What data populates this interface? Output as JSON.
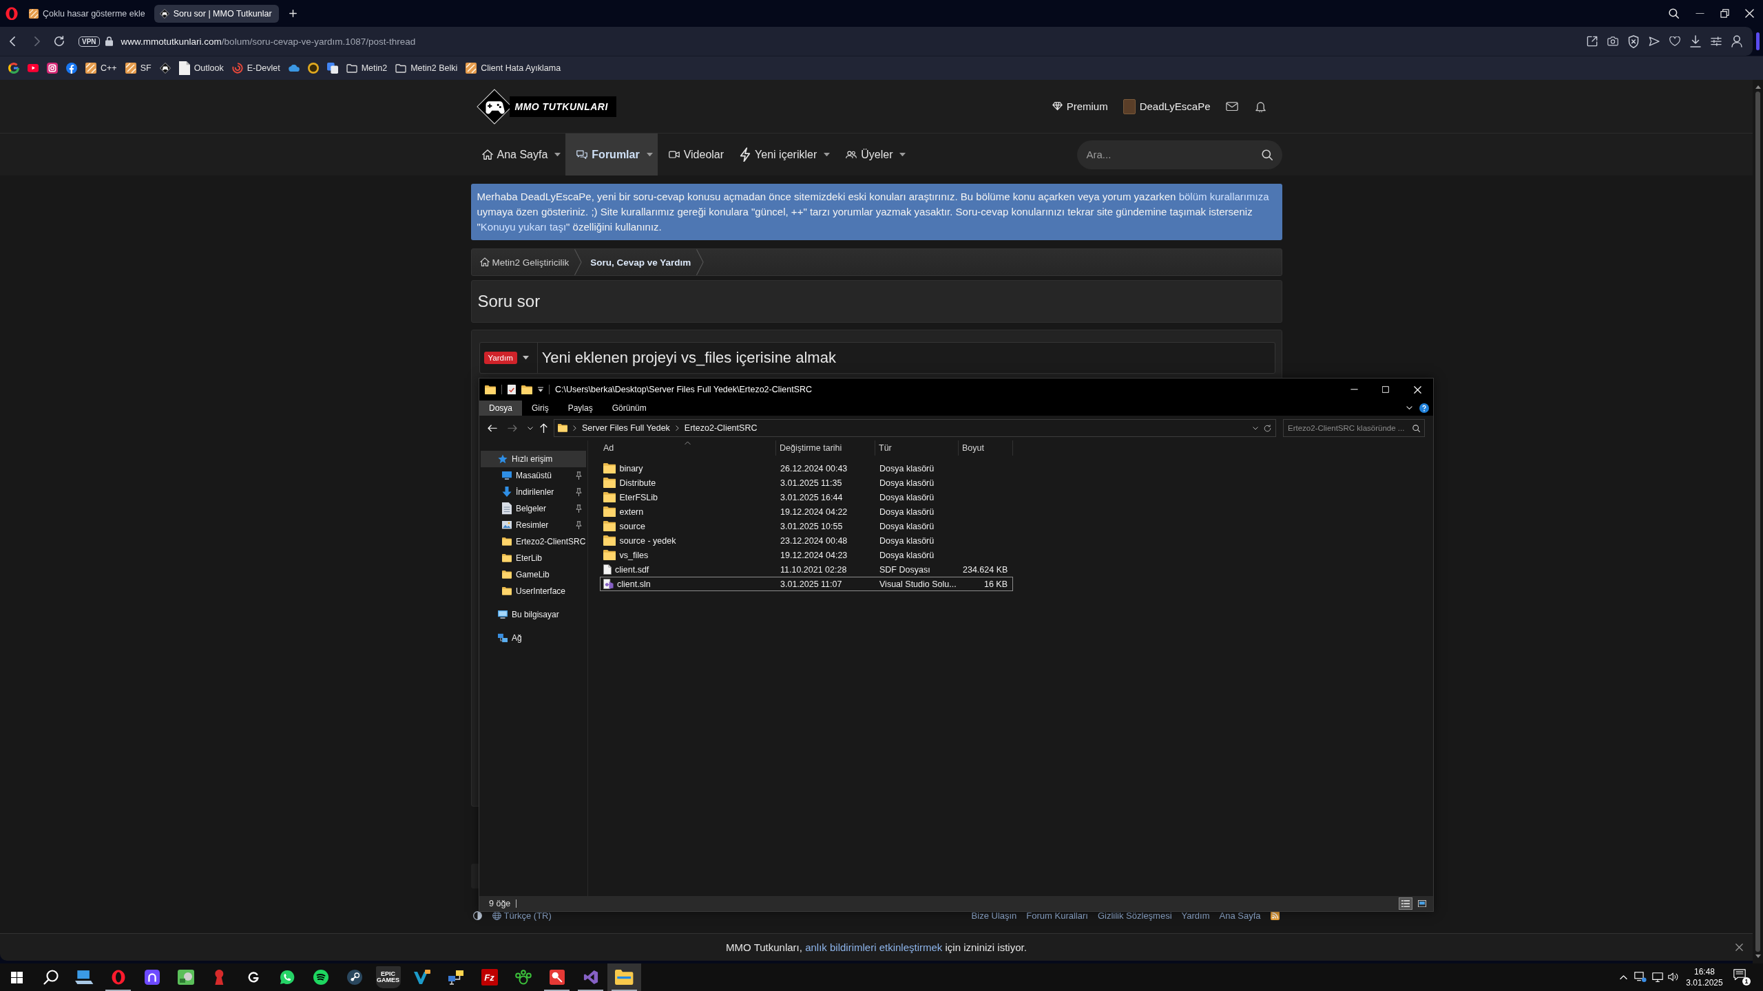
{
  "browser": {
    "tabs": [
      {
        "kind": "tile",
        "title": "Çoklu hasar gösterme ekle",
        "selected": false
      },
      {
        "kind": "mascot",
        "title": "Soru sor | MMO Tutkunlar",
        "selected": true
      }
    ],
    "history": {
      "can_go_back": true,
      "can_go_forward": false
    },
    "address": {
      "badge": "VPN",
      "host": "www.mmotutkunlari.com",
      "path": "/bolum/soru-cevap-ve-yardım.1087/post-thread"
    },
    "bookmarks": [
      {
        "kind": "google"
      },
      {
        "kind": "youtube"
      },
      {
        "kind": "instagram"
      },
      {
        "kind": "facebook"
      },
      {
        "kind": "tile",
        "label": "C++"
      },
      {
        "kind": "tile",
        "label": "SF"
      },
      {
        "kind": "mascot"
      },
      {
        "kind": "page",
        "label": "Outlook"
      },
      {
        "kind": "swirl",
        "label": "E-Devlet"
      },
      {
        "kind": "cloud"
      },
      {
        "kind": "coin"
      },
      {
        "kind": "translate"
      },
      {
        "kind": "folder",
        "label": "Metin2"
      },
      {
        "kind": "folder",
        "label": "Metin2 Belki"
      },
      {
        "kind": "tile",
        "label": "Client Hata Ayıklama"
      }
    ]
  },
  "site": {
    "logo": "MMO TUTKUNLARI",
    "account": [
      {
        "kind": "premium",
        "label": "Premium"
      },
      {
        "kind": "user",
        "label": "DeadLyEscaPe"
      },
      {
        "kind": "mail"
      },
      {
        "kind": "bell"
      }
    ],
    "nav": [
      {
        "kind": "home",
        "label": "Ana Sayfa",
        "dropdown": true,
        "selected": false
      },
      {
        "kind": "chat",
        "label": "Forumlar",
        "dropdown": true,
        "selected": true
      },
      {
        "kind": "video",
        "label": "Videolar",
        "dropdown": false,
        "selected": false
      },
      {
        "kind": "bolt",
        "label": "Yeni içerikler",
        "dropdown": true,
        "selected": false
      },
      {
        "kind": "users",
        "label": "Üyeler",
        "dropdown": true,
        "selected": false
      }
    ],
    "search": {
      "placeholder": "Ara..."
    },
    "notice": [
      {
        "kind": "text",
        "text": "Merhaba DeadLyEscaPe, yeni bir soru-cevap konusu açmadan önce sitemizdeki eski konuları araştırınız. Bu bölüme konu açarken veya yorum yazarken "
      },
      {
        "kind": "link",
        "text": "bölüm kurallarımıza"
      },
      {
        "kind": "text",
        "text": " uymaya özen gösteriniz. ;) Site kurallarımız gereği konulara \"güncel, ++\" tarzı yorumlar yazmak yasaktır. Soru-cevap konularınızı tekrar site gündemine taşımak isterseniz \""
      },
      {
        "kind": "link",
        "text": "Konuyu yukarı taşı"
      },
      {
        "kind": "text",
        "text": "\" özelliğini kullanınız."
      }
    ],
    "breadcrumb": [
      {
        "label": "Metin2 Geliştiricilik",
        "current": false
      },
      {
        "label": "Soru, Cevap ve Yardım",
        "current": true
      }
    ],
    "page_title": "Soru sor",
    "form": {
      "prefix": "Yardım",
      "title_field": {
        "value": "Yeni eklenen projeyi vs_files içerisine almak"
      }
    },
    "footer": {
      "language": "Türkçe (TR)",
      "links": [
        "Bize Ulaşın",
        "Forum Kuralları",
        "Gizlilik Sözleşmesi",
        "Yardım",
        "Ana Sayfa"
      ]
    }
  },
  "explorer": {
    "title": "C:\\Users\\berka\\Desktop\\Server Files Full Yedek\\Ertezo2-ClientSRC",
    "ribbon_tabs": [
      {
        "label": "Dosya",
        "selected": true
      },
      {
        "label": "Giriş",
        "selected": false
      },
      {
        "label": "Paylaş",
        "selected": false
      },
      {
        "label": "Görünüm",
        "selected": false
      }
    ],
    "history": {
      "can_go_back": true,
      "can_go_forward": false
    },
    "path": [
      "Server Files Full Yedek",
      "Ertezo2-ClientSRC"
    ],
    "search": {
      "placeholder": "Ertezo2-ClientSRC klasöründe ..."
    },
    "nav": [
      {
        "kind": "star",
        "label": "Hızlı erişim",
        "selected": true,
        "children": [
          {
            "kind": "desktop",
            "label": "Masaüstü",
            "pinned": true,
            "selected": false
          },
          {
            "kind": "downloads",
            "label": "İndirilenler",
            "pinned": true,
            "selected": false
          },
          {
            "kind": "documents",
            "label": "Belgeler",
            "pinned": true,
            "selected": false
          },
          {
            "kind": "pictures",
            "label": "Resimler",
            "pinned": true,
            "selected": false
          },
          {
            "kind": "folder",
            "label": "Ertezo2-ClientSRC",
            "pinned": false,
            "selected": false
          },
          {
            "kind": "folder",
            "label": "EterLib",
            "pinned": false,
            "selected": false
          },
          {
            "kind": "folder",
            "label": "GameLib",
            "pinned": false,
            "selected": false
          },
          {
            "kind": "folder",
            "label": "UserInterface",
            "pinned": false,
            "selected": false
          }
        ]
      },
      {
        "kind": "computer",
        "label": "Bu bilgisayar",
        "selected": false
      },
      {
        "kind": "network",
        "label": "Ağ",
        "selected": false
      }
    ],
    "columns": [
      {
        "label": "Ad",
        "sorted": true
      },
      {
        "label": "Değiştirme tarihi",
        "sorted": false
      },
      {
        "label": "Tür",
        "sorted": false
      },
      {
        "label": "Boyut",
        "sorted": false
      }
    ],
    "rows": [
      {
        "kind": "folder",
        "name": "binary",
        "modified": "26.12.2024 00:43",
        "type": "Dosya klasörü",
        "selected": false,
        "focused": false
      },
      {
        "kind": "folder",
        "name": "Distribute",
        "modified": "3.01.2025 11:35",
        "type": "Dosya klasörü",
        "selected": false,
        "focused": false
      },
      {
        "kind": "folder",
        "name": "EterFSLib",
        "modified": "3.01.2025 16:44",
        "type": "Dosya klasörü",
        "selected": false,
        "focused": false
      },
      {
        "kind": "folder",
        "name": "extern",
        "modified": "19.12.2024 04:22",
        "type": "Dosya klasörü",
        "selected": false,
        "focused": false
      },
      {
        "kind": "folder",
        "name": "source",
        "modified": "3.01.2025 10:55",
        "type": "Dosya klasörü",
        "selected": false,
        "focused": false
      },
      {
        "kind": "folder",
        "name": "source - yedek",
        "modified": "23.12.2024 00:48",
        "type": "Dosya klasörü",
        "selected": false,
        "focused": false
      },
      {
        "kind": "folder",
        "name": "vs_files",
        "modified": "19.12.2024 04:23",
        "type": "Dosya klasörü",
        "selected": false,
        "focused": false
      },
      {
        "kind": "file",
        "name": "client.sdf",
        "modified": "11.10.2021 02:28",
        "type": "SDF Dosyası",
        "size": "234.624 KB",
        "selected": false,
        "focused": false
      },
      {
        "kind": "solution",
        "name": "client.sln",
        "modified": "3.01.2025 11:07",
        "type": "Visual Studio Solu...",
        "size": "16 KB",
        "selected": false,
        "focused": true
      }
    ],
    "status": "9 öğe",
    "views": [
      {
        "kind": "details",
        "selected": true
      },
      {
        "kind": "tiles",
        "selected": false
      }
    ]
  },
  "notification": [
    {
      "kind": "text",
      "text": "MMO Tutkunları, "
    },
    {
      "kind": "link",
      "text": "anlık bildirimleri etkinleştirmek"
    },
    {
      "kind": "text",
      "text": " için izninizi istiyor."
    }
  ],
  "taskbar": {
    "apps": [
      {
        "kind": "start",
        "running": false,
        "active": false
      },
      {
        "kind": "search",
        "running": false,
        "active": false
      },
      {
        "kind": "laptop",
        "running": false,
        "active": false
      },
      {
        "kind": "ring",
        "running": true,
        "active": false
      },
      {
        "kind": "arch",
        "running": false,
        "active": false
      },
      {
        "kind": "disc",
        "running": false,
        "active": false
      },
      {
        "kind": "figure",
        "running": false,
        "active": false
      },
      {
        "kind": "g",
        "running": false,
        "active": false
      },
      {
        "kind": "bubble",
        "running": false,
        "active": false
      },
      {
        "kind": "waves",
        "running": false,
        "active": false
      },
      {
        "kind": "knob",
        "running": false,
        "active": false
      },
      {
        "kind": "shield",
        "label": "EPIC GAMES",
        "running": false,
        "active": false
      },
      {
        "kind": "v",
        "running": false,
        "active": false
      },
      {
        "kind": "network",
        "running": false,
        "active": false
      },
      {
        "kind": "tile",
        "label": "Fz",
        "running": false,
        "active": false
      },
      {
        "kind": "paw",
        "running": false,
        "active": false
      },
      {
        "kind": "sphere",
        "running": true,
        "active": false
      },
      {
        "kind": "ribbon",
        "running": true,
        "active": false
      },
      {
        "kind": "folder",
        "running": true,
        "active": true
      }
    ],
    "clock": {
      "time": "16:48",
      "date": "3.01.2025"
    },
    "notifications": "1"
  }
}
